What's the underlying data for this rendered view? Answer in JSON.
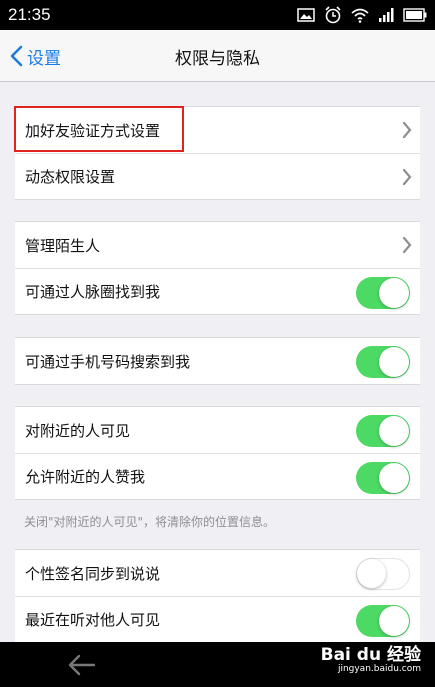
{
  "status": {
    "time": "21:35"
  },
  "nav": {
    "back_label": "设置",
    "title": "权限与隐私"
  },
  "groups": [
    {
      "rows": [
        {
          "label": "加好友验证方式设置",
          "control": "chevron"
        },
        {
          "label": "动态权限设置",
          "control": "chevron"
        }
      ]
    },
    {
      "rows": [
        {
          "label": "管理陌生人",
          "control": "chevron"
        },
        {
          "label": "可通过人脉圈找到我",
          "control": "toggle",
          "on": true
        }
      ]
    },
    {
      "rows": [
        {
          "label": "可通过手机号码搜索到我",
          "control": "toggle",
          "on": true
        }
      ]
    },
    {
      "rows": [
        {
          "label": "对附近的人可见",
          "control": "toggle",
          "on": true
        },
        {
          "label": "允许附近的人赞我",
          "control": "toggle",
          "on": true
        }
      ]
    },
    {
      "rows": [
        {
          "label": "个性签名同步到说说",
          "control": "toggle",
          "on": false
        },
        {
          "label": "最近在听对他人可见",
          "control": "toggle",
          "on": true
        }
      ]
    }
  ],
  "footnote": "关闭\"对附近的人可见\"，将清除你的位置信息。",
  "watermark": {
    "line1": "Bai du 经验",
    "line2": "jingyan.baidu.com"
  },
  "colors": {
    "accent": "#1c7ce5",
    "toggle_on": "#4cd964",
    "highlight": "#e0231e"
  }
}
